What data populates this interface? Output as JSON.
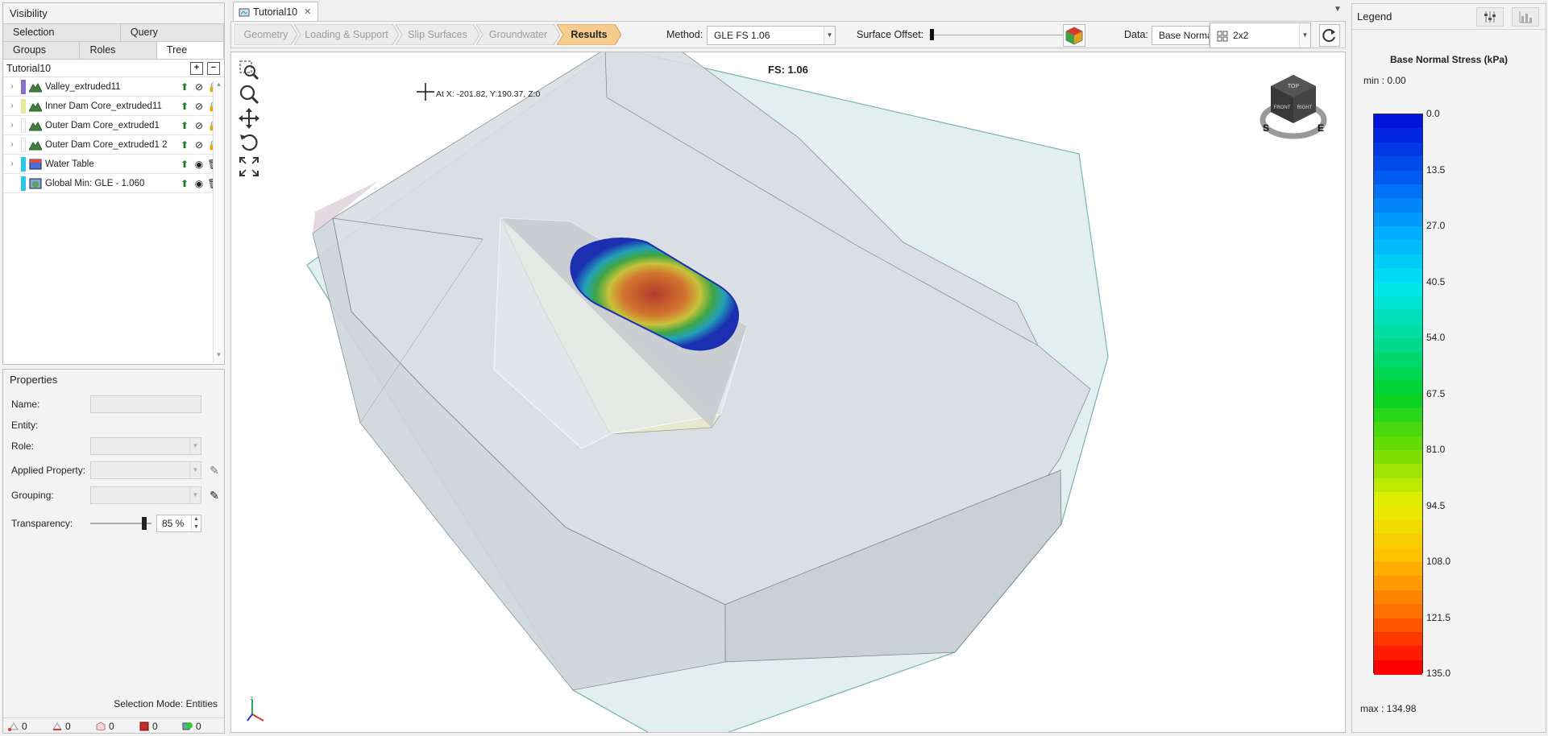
{
  "visibility": {
    "title": "Visibility",
    "tabs_row1": [
      "Selection",
      "Query"
    ],
    "tabs_row2": [
      "Groups",
      "Roles",
      "Tree"
    ],
    "tree_root": "Tutorial10",
    "items": [
      {
        "label": "Valley_extruded11",
        "swatch": "#8c6fc2",
        "eye": "hidden",
        "lock": true
      },
      {
        "label": "Inner Dam Core_extruded11",
        "swatch": "#e8e89a",
        "eye": "hidden",
        "lock": true
      },
      {
        "label": "Outer Dam Core_extruded1",
        "swatch": "#ffffff",
        "eye": "hidden",
        "lock": true
      },
      {
        "label": "Outer Dam Core_extruded1 2",
        "swatch": "#ffffff",
        "eye": "hidden",
        "lock": true
      },
      {
        "label": "Water Table",
        "swatch": "#2ec5e6",
        "eye": "visible",
        "lock": false
      },
      {
        "label": "Global Min: GLE  -  1.060",
        "swatch": "#2ec5e6",
        "eye": "visible",
        "lock": false
      }
    ]
  },
  "properties": {
    "title": "Properties",
    "name_label": "Name:",
    "entity_label": "Entity:",
    "role_label": "Role:",
    "applied_label": "Applied Property:",
    "grouping_label": "Grouping:",
    "transparency_label": "Transparency:",
    "transparency_value": "85 %",
    "selection_mode": "Selection Mode: Entities",
    "counts": [
      "0",
      "0",
      "0",
      "0",
      "0"
    ]
  },
  "document_tab": "Tutorial10",
  "workflow_steps": [
    "Geometry",
    "Loading & Support",
    "Slip Surfaces",
    "Groundwater",
    "Results"
  ],
  "toolbar": {
    "method_label": "Method:",
    "method_value": "GLE FS    1.06",
    "offset_label": "Surface Offset:",
    "data_label": "Data:",
    "data_value": "Base Normal",
    "layout_value": "2x2"
  },
  "viewport": {
    "fs_label": "FS: 1.06",
    "coord_readout": "At X: -201.82, Y:190.37, Z:0",
    "cube_labels": [
      "TOP",
      "FRONT",
      "RIGHT",
      "S",
      "E"
    ]
  },
  "legend": {
    "title": "Legend",
    "variable": "Base Normal Stress (kPa)",
    "min_text": "min :   0.00",
    "max_text": "max :  134.98",
    "ticks": [
      "0.0",
      "13.5",
      "27.0",
      "40.5",
      "54.0",
      "67.5",
      "81.0",
      "94.5",
      "108.0",
      "121.5",
      "135.0"
    ]
  },
  "colors": {
    "accent_results": "#f7cc8f",
    "selected_tab": "#ffffff"
  }
}
